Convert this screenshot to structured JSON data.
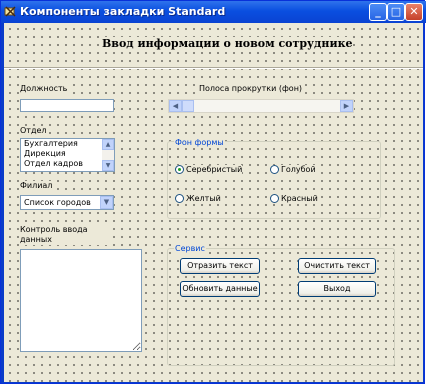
{
  "window": {
    "title": "Компоненты закладки Standard",
    "minimize": "_",
    "maximize": "□",
    "close": "✕"
  },
  "form": {
    "heading": "Ввод информации о новом сотруднике",
    "position_label": "Должность",
    "position_value": "",
    "department_label": "Отдел",
    "department_items": [
      "Бухгалтерия",
      "Дирекция",
      "Отдел кадров"
    ],
    "branch_label": "Филиал",
    "branch_value": "Список городов",
    "control_label": "Контроль ввода данных",
    "scroll_label": "Полоса прокрутки (фон)",
    "background_group": "Фон формы",
    "radios": [
      {
        "label": "Серебристый",
        "checked": true
      },
      {
        "label": "Голубой",
        "checked": false
      },
      {
        "label": "Желтый",
        "checked": false
      },
      {
        "label": "Красный",
        "checked": false
      }
    ],
    "service_group": "Сервис",
    "buttons": {
      "reflect": "Отразить текст",
      "clear": "Очистить текст",
      "refresh": "Обновить данные",
      "exit": "Выход"
    }
  },
  "icons": {
    "app": "app-icon",
    "up": "▲",
    "down": "▼",
    "left": "◀",
    "right": "▶",
    "dropdown": "▼"
  },
  "colors": {
    "titlebar": "#0a4fe0",
    "form_bg": "#ece9d8",
    "group_title": "#0046d5"
  }
}
